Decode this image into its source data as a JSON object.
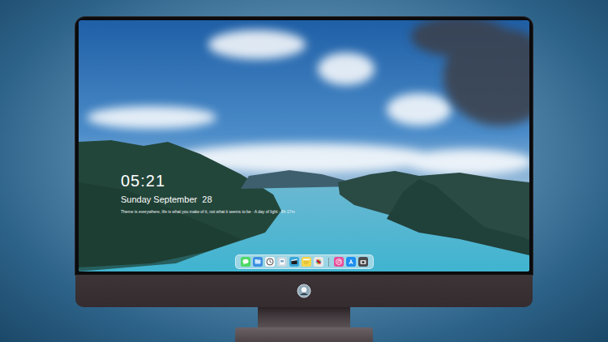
{
  "lock_screen": {
    "time": "05:21",
    "date": "Sunday September  28",
    "quote": "Theme is everywhere, life is what you make of it, not what it seems to be · A day of light · 8h 17m"
  },
  "dock": {
    "items": [
      {
        "kind": "messages",
        "color": "#4cd964"
      },
      {
        "kind": "files",
        "color": "#3b8fe0"
      },
      {
        "kind": "clock",
        "color": "#f4f4f4"
      },
      {
        "kind": "preview",
        "color": "#c9d6e0"
      },
      {
        "kind": "video",
        "color": "#3aa6d8"
      },
      {
        "kind": "notes",
        "color": "#f7d54a"
      },
      {
        "kind": "photos",
        "color": "#e8e8e8"
      },
      {
        "kind": "music",
        "color": "#e84c9a"
      },
      {
        "kind": "appstore",
        "color": "#1c8ef0"
      },
      {
        "kind": "camera",
        "color": "#4a4a4e"
      }
    ],
    "separator_after": 6
  }
}
